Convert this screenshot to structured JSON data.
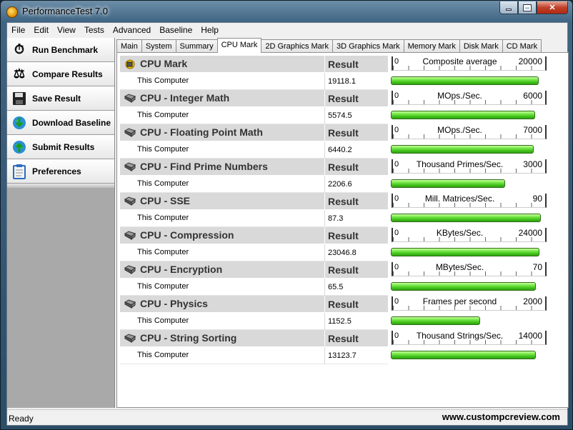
{
  "window": {
    "title": "PerformanceTest 7.0"
  },
  "menu": [
    "File",
    "Edit",
    "View",
    "Tests",
    "Advanced",
    "Baseline",
    "Help"
  ],
  "sidebar": [
    {
      "label": "Run Benchmark",
      "icon": "stopwatch-icon"
    },
    {
      "label": "Compare Results",
      "icon": "scales-icon"
    },
    {
      "label": "Save Result",
      "icon": "floppy-disk-icon"
    },
    {
      "label": "Download Baseline",
      "icon": "globe-download-icon"
    },
    {
      "label": "Submit Results",
      "icon": "globe-upload-icon"
    },
    {
      "label": "Preferences",
      "icon": "clipboard-icon"
    }
  ],
  "tabs": [
    "Main",
    "System",
    "Summary",
    "CPU Mark",
    "2D Graphics Mark",
    "3D Graphics Mark",
    "Memory Mark",
    "Disk Mark",
    "CD Mark"
  ],
  "active_tab": "CPU Mark",
  "result_header": "Result",
  "row_label": "This Computer",
  "tests": [
    {
      "name": "CPU Mark",
      "icon": "cpu-mark-icon",
      "value": "19118.1",
      "min": "0",
      "unit": "Composite average",
      "max": "20000",
      "fill": 0.956
    },
    {
      "name": "CPU - Integer Math",
      "icon": "chip-icon",
      "value": "5574.5",
      "min": "0",
      "unit": "MOps./Sec.",
      "max": "6000",
      "fill": 0.929
    },
    {
      "name": "CPU - Floating Point Math",
      "icon": "chip-icon",
      "value": "6440.2",
      "min": "0",
      "unit": "MOps./Sec.",
      "max": "7000",
      "fill": 0.92
    },
    {
      "name": "CPU - Find Prime Numbers",
      "icon": "chip-icon",
      "value": "2206.6",
      "min": "0",
      "unit": "Thousand Primes/Sec.",
      "max": "3000",
      "fill": 0.736
    },
    {
      "name": "CPU - SSE",
      "icon": "chip-icon",
      "value": "87.3",
      "min": "0",
      "unit": "Mill. Matrices/Sec.",
      "max": "90",
      "fill": 0.97
    },
    {
      "name": "CPU - Compression",
      "icon": "chip-icon",
      "value": "23046.8",
      "min": "0",
      "unit": "KBytes/Sec.",
      "max": "24000",
      "fill": 0.96
    },
    {
      "name": "CPU - Encryption",
      "icon": "chip-icon",
      "value": "65.5",
      "min": "0",
      "unit": "MBytes/Sec.",
      "max": "70",
      "fill": 0.936
    },
    {
      "name": "CPU - Physics",
      "icon": "chip-icon",
      "value": "1152.5",
      "min": "0",
      "unit": "Frames per second",
      "max": "2000",
      "fill": 0.576
    },
    {
      "name": "CPU - String Sorting",
      "icon": "chip-icon",
      "value": "13123.7",
      "min": "0",
      "unit": "Thousand Strings/Sec.",
      "max": "14000",
      "fill": 0.937
    }
  ],
  "status": {
    "text": "Ready",
    "watermark": "www.custompcreview.com"
  }
}
